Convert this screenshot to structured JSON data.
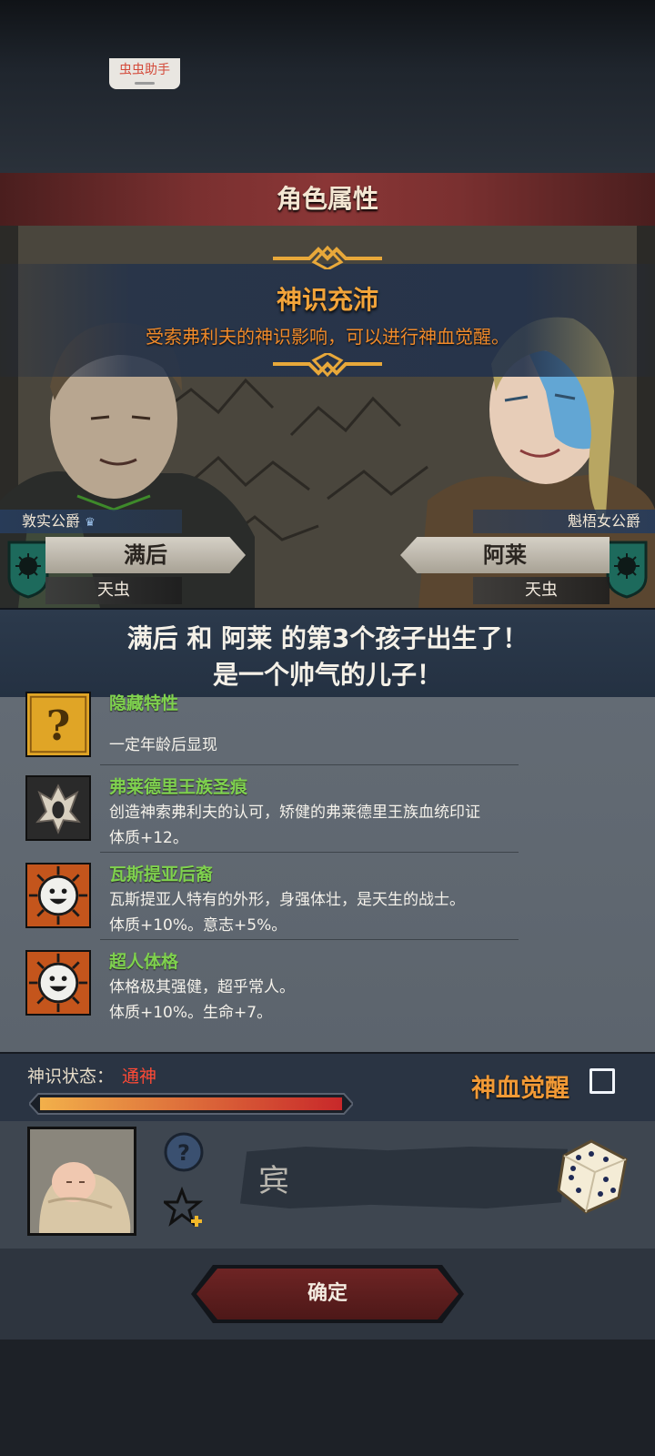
{
  "overlay": {
    "helper_label": "虫虫助手"
  },
  "header": {
    "title": "角色属性"
  },
  "notice": {
    "title": "神识充沛",
    "text": "受索弗利夫的神识影响，可以进行神血觉醒。"
  },
  "parents": {
    "left": {
      "rank": "敦实公爵",
      "name": "满后",
      "subtitle": "天虫"
    },
    "right": {
      "rank": "魁梧女公爵",
      "name": "阿莱",
      "subtitle": "天虫"
    }
  },
  "birth": {
    "line1": "满后 和 阿莱 的第3个孩子出生了！",
    "line2": "是一个帅气的儿子！"
  },
  "traits": [
    {
      "name": "隐藏特性",
      "desc1": "",
      "desc2": "一定年龄后显现",
      "icon": "question-mark-icon"
    },
    {
      "name": "弗莱德里王族圣痕",
      "desc1": "创造神索弗利夫的认可，矫健的弗莱德里王族血统印证",
      "desc2": "体质+12。",
      "icon": "royal-stigma-icon"
    },
    {
      "name": "瓦斯提亚后裔",
      "desc1": "瓦斯提亚人特有的外形，身强体壮，是天生的战士。",
      "desc2": "体质+10%。意志+5%。",
      "icon": "smiling-sun-icon"
    },
    {
      "name": "超人体格",
      "desc1": "体格极其强健，超乎常人。",
      "desc2": "体质+10%。生命+7。",
      "icon": "smiling-sun-icon"
    }
  ],
  "status": {
    "label": "神识状态：",
    "value": "通神",
    "progress": 1.0,
    "awaken_label": "神血觉醒",
    "awaken_checked": false
  },
  "child": {
    "name": "宾"
  },
  "actions": {
    "confirm_label": "确定"
  },
  "colors": {
    "accent_orange": "#f29a36",
    "trait_green": "#7fd24e",
    "status_red": "#ff4a36"
  }
}
